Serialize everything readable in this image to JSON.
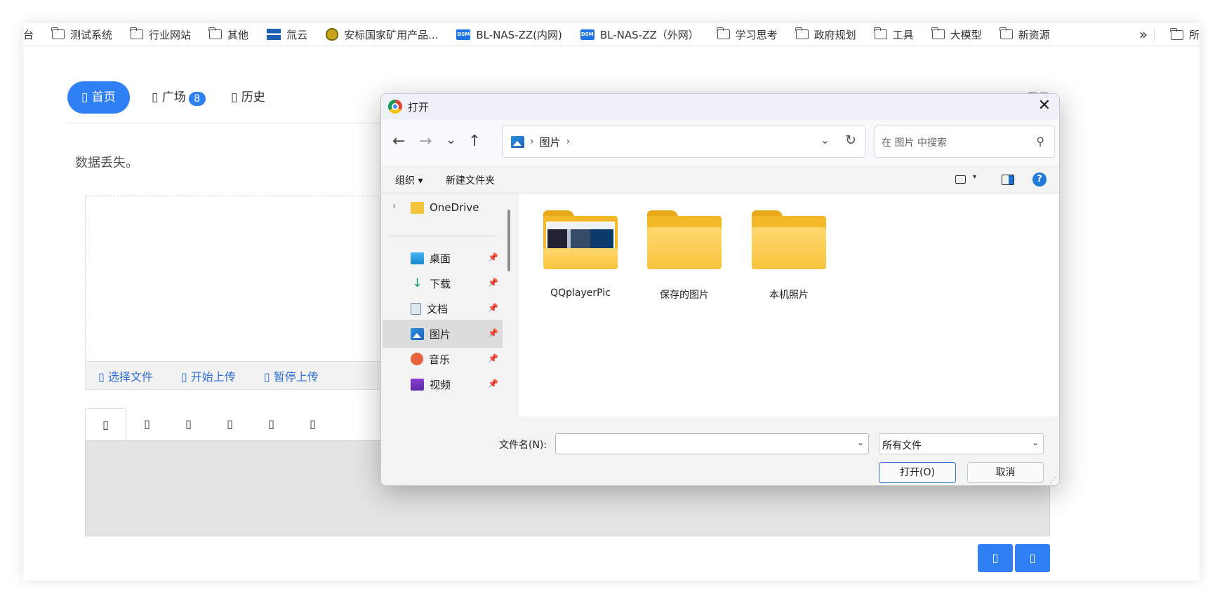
{
  "bookmarks": [
    {
      "label": "台",
      "icon": "none"
    },
    {
      "label": "测试系统",
      "icon": "folder-icon"
    },
    {
      "label": "行业网站",
      "icon": "folder-icon"
    },
    {
      "label": "其他",
      "icon": "folder-icon"
    },
    {
      "label": "氚云",
      "icon": "cloud-logo-icon"
    },
    {
      "label": "安标国家矿用产品...",
      "icon": "shield-badge-icon"
    },
    {
      "label": "BL-NAS-ZZ(内网)",
      "icon": "dsm-icon"
    },
    {
      "label": "BL-NAS-ZZ（外网）",
      "icon": "dsm-icon"
    },
    {
      "label": "学习思考",
      "icon": "folder-icon"
    },
    {
      "label": "政府规划",
      "icon": "folder-icon"
    },
    {
      "label": "工具",
      "icon": "folder-icon"
    },
    {
      "label": "大模型",
      "icon": "folder-icon"
    },
    {
      "label": "新资源",
      "icon": "folder-icon"
    }
  ],
  "bookmarks_more": "»",
  "bookmarks_last": "所",
  "dsm_text": "DSM",
  "page": {
    "nav": [
      {
        "label": "▯ 首页",
        "active": true
      },
      {
        "label": "▯ 广场",
        "count": "8"
      },
      {
        "label": "▯ 历史"
      }
    ],
    "login": "▯ 登录",
    "notice": "数据丢失。",
    "upload_actions": [
      "▯ 选择文件",
      "▯ 开始上传",
      "▯ 暂停上传"
    ],
    "tabs": [
      "▯",
      "▯",
      "▯",
      "▯",
      "▯",
      "▯"
    ],
    "bottom_buttons": [
      "▯",
      "▯"
    ],
    "accent_color": "#2f7ff5"
  },
  "dialog": {
    "title": "打开",
    "close": "✕",
    "nav": {
      "back": "←",
      "forward": "→",
      "recent": "⌄",
      "up": "↑"
    },
    "address": {
      "crumb": "图片",
      "sep": "›",
      "dropdown": "⌄",
      "refresh": "↻"
    },
    "search": {
      "placeholder": "在 图片 中搜索",
      "icon": "⚲"
    },
    "toolbar": {
      "organize": "组织 ▾",
      "new_folder": "新建文件夹",
      "view_dd": "▾",
      "help": "?"
    },
    "sidebar": {
      "expander": "›",
      "top": {
        "label": "OneDrive",
        "icon": "folder-icon"
      },
      "quick": [
        {
          "label": "桌面",
          "icon": "desktop-icon",
          "pin": "📌"
        },
        {
          "label": "下载",
          "icon": "download-icon",
          "pin": "📌"
        },
        {
          "label": "文档",
          "icon": "document-icon",
          "pin": "📌"
        },
        {
          "label": "图片",
          "icon": "pictures-icon",
          "pin": "📌",
          "selected": true
        },
        {
          "label": "音乐",
          "icon": "music-icon",
          "pin": "📌"
        },
        {
          "label": "视频",
          "icon": "video-icon",
          "pin": "📌"
        }
      ]
    },
    "files": [
      {
        "name": "QQplayerPic",
        "thumbnail": true
      },
      {
        "name": "保存的图片"
      },
      {
        "name": "本机照片"
      }
    ],
    "filename_label": "文件名(N):",
    "filename_value": "",
    "filetype": "所有文件",
    "dropdown_arrow": "⌄",
    "open_btn": "打开(O)",
    "cancel_btn": "取消",
    "grip": "⋰"
  }
}
